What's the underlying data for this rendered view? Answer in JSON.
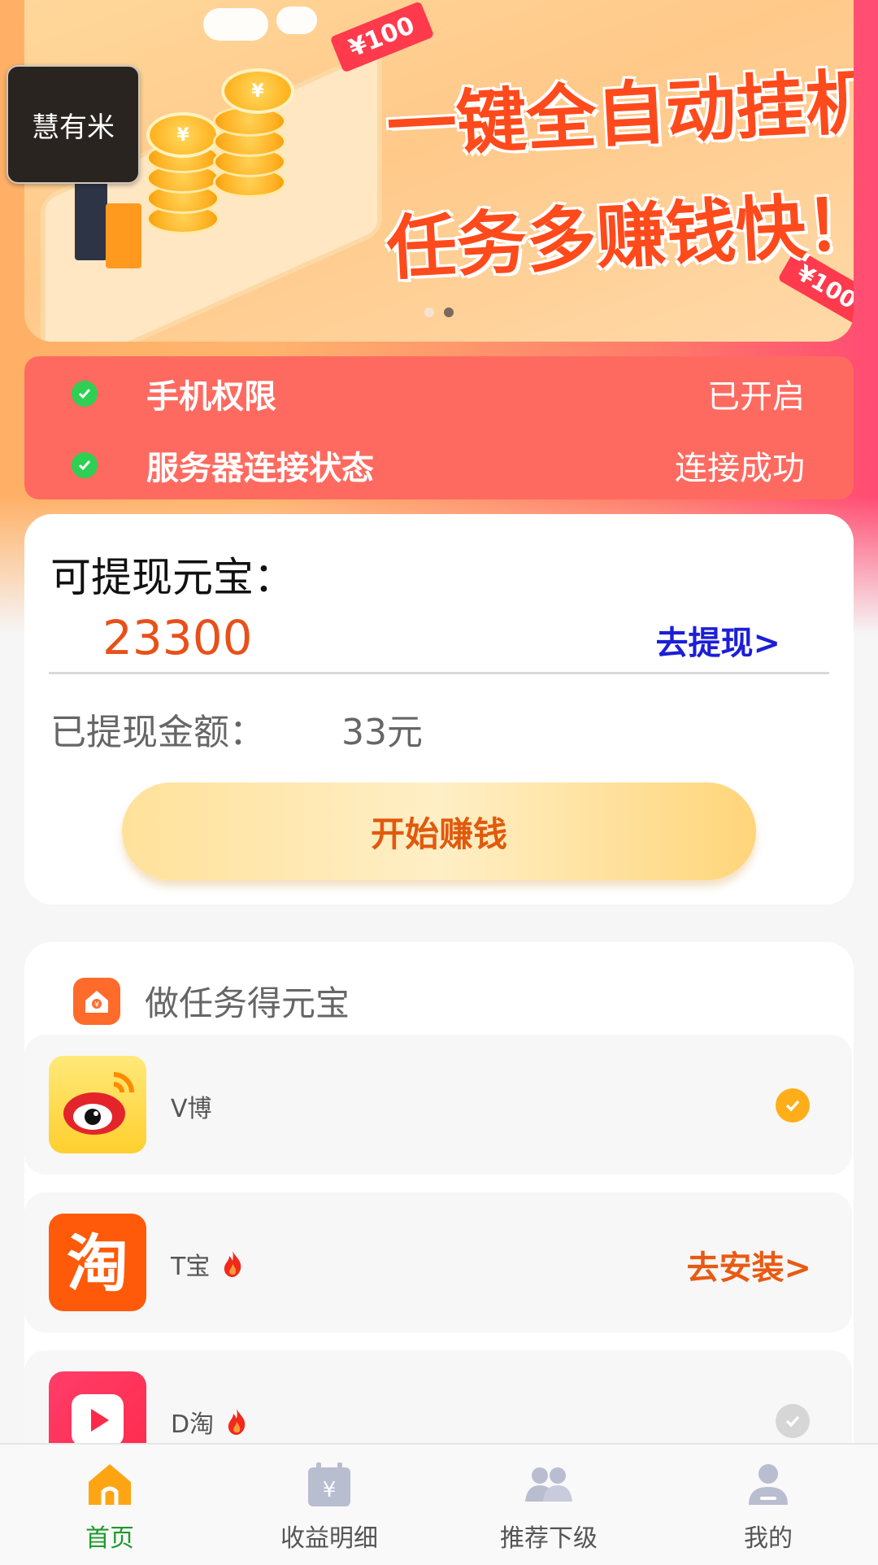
{
  "banner": {
    "badge_top": "¥100",
    "badge_bottom": "¥100",
    "slogan_line1": "一键全自动挂机",
    "slogan_line2": "任务多赚钱快！",
    "coin_symbol": "¥",
    "active_slide": 2,
    "slide_count": 2
  },
  "app_overlay": {
    "name": "慧有米"
  },
  "status": {
    "rows": [
      {
        "label": "手机权限",
        "value": "已开启"
      },
      {
        "label": "服务器连接状态",
        "value": "连接成功"
      }
    ]
  },
  "balance": {
    "title": "可提现元宝：",
    "amount": "23300",
    "withdraw_link": "去提现>",
    "withdrawn_label": "已提现金额：",
    "withdrawn_value": "33元",
    "start_button": "开始赚钱"
  },
  "tasks": {
    "title": "做任务得元宝",
    "items": [
      {
        "name": "V博",
        "hot": false,
        "state": "done"
      },
      {
        "name": "T宝",
        "hot": true,
        "state": "install",
        "action": "去安装>"
      },
      {
        "name": "D淘",
        "hot": true,
        "state": "pending"
      }
    ]
  },
  "nav": {
    "items": [
      {
        "label": "首页",
        "icon": "home-icon",
        "active": true
      },
      {
        "label": "收益明细",
        "icon": "calendar-yen-icon",
        "active": false
      },
      {
        "label": "推荐下级",
        "icon": "users-icon",
        "active": false
      },
      {
        "label": "我的",
        "icon": "user-icon",
        "active": false
      }
    ]
  },
  "colors": {
    "accent_orange": "#e8501a",
    "link_blue": "#1c1fd6",
    "active_green": "#1f9a2c",
    "status_red": "#ff6a60"
  }
}
